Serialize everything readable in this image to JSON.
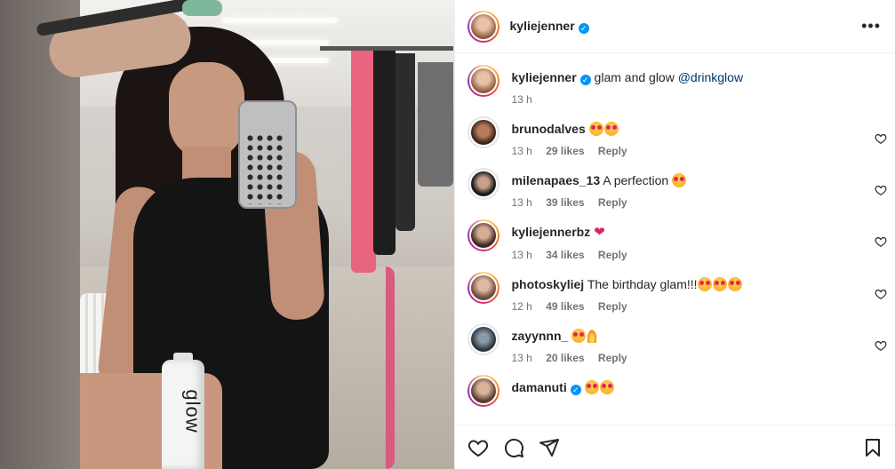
{
  "post_author": {
    "username": "kyliejenner",
    "verified": true
  },
  "caption": {
    "username": "kyliejenner",
    "text": "glam and glow",
    "mention": "@drinkglow",
    "time": "13 h"
  },
  "comments": [
    {
      "username": "brunodalves",
      "text": "",
      "emoji": "🤩🤩",
      "time": "13 h",
      "likes": "29 likes",
      "reply": "Reply"
    },
    {
      "username": "milenapaes_13",
      "text": "A perfection",
      "emoji": "🤩",
      "time": "13 h",
      "likes": "39 likes",
      "reply": "Reply"
    },
    {
      "username": "kyliejennerbz",
      "text": "",
      "emoji": "❤️",
      "time": "13 h",
      "likes": "34 likes",
      "reply": "Reply"
    },
    {
      "username": "photoskyliej",
      "text": "The birthday glam!!!",
      "emoji": "🤩🤩🤩",
      "time": "12 h",
      "likes": "49 likes",
      "reply": "Reply"
    },
    {
      "username": "zayynnn_",
      "text": "",
      "emoji": "🤩🔥",
      "time": "13 h",
      "likes": "20 likes",
      "reply": "Reply"
    },
    {
      "username": "damanuti",
      "text": "",
      "emoji": "🤩🤩",
      "time": "",
      "likes": "",
      "reply": ""
    }
  ],
  "photo": {
    "bottle_text": "glow"
  },
  "icons": {
    "more": "more-options-icon",
    "like": "heart-icon",
    "comment": "comment-icon",
    "share": "share-icon",
    "save": "bookmark-icon"
  },
  "colors": {
    "verified": "#0095f6",
    "mention": "#00376b",
    "muted": "#737373"
  }
}
